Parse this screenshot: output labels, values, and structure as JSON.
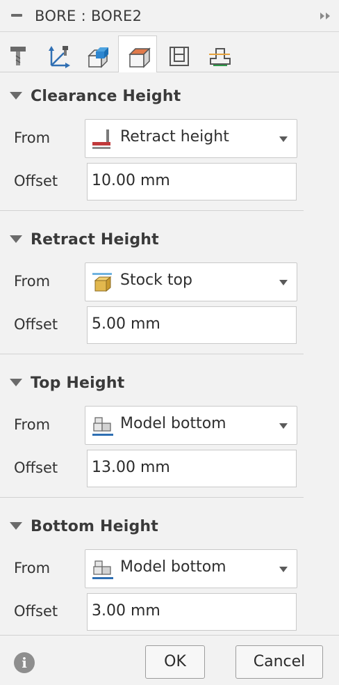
{
  "window": {
    "title": "BORE : BORE2"
  },
  "tabs": [
    {
      "icon": "tool-icon"
    },
    {
      "icon": "geometry-axes-icon"
    },
    {
      "icon": "stock-box-icon"
    },
    {
      "icon": "heights-icon",
      "active": true
    },
    {
      "icon": "passes-icon"
    },
    {
      "icon": "linking-icon"
    }
  ],
  "sections": {
    "clearance": {
      "title": "Clearance Height",
      "from_label": "From",
      "from_value": "Retract height",
      "offset_label": "Offset",
      "offset_value": "10.00 mm"
    },
    "retract": {
      "title": "Retract Height",
      "from_label": "From",
      "from_value": "Stock top",
      "offset_label": "Offset",
      "offset_value": "5.00 mm"
    },
    "top": {
      "title": "Top Height",
      "from_label": "From",
      "from_value": "Model bottom",
      "offset_label": "Offset",
      "offset_value": "13.00 mm"
    },
    "bottom": {
      "title": "Bottom Height",
      "from_label": "From",
      "from_value": "Model bottom",
      "offset_label": "Offset",
      "offset_value": "3.00 mm"
    }
  },
  "footer": {
    "info_glyph": "i",
    "ok_label": "OK",
    "cancel_label": "Cancel"
  },
  "colors": {
    "panel_bg": "#f2f2f2",
    "field_bg": "#ffffff",
    "accent_red": "#c0393b",
    "accent_blue": "#2f6fb3",
    "stock_gold": "#e2b84e",
    "stock_top_line": "#6fb3e0"
  }
}
